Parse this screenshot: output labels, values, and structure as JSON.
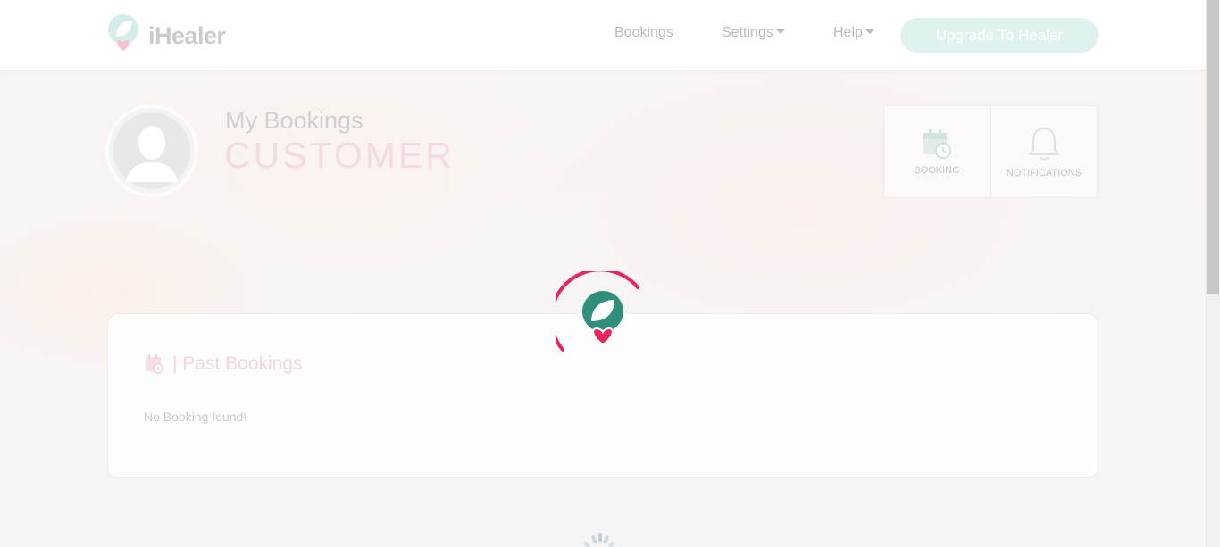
{
  "brand": {
    "name": "iHealer"
  },
  "nav": {
    "bookings": "Bookings",
    "settings": "Settings",
    "help": "Help",
    "upgrade": "Upgrade To Healer"
  },
  "profile": {
    "subtitle": "My Bookings",
    "title": "CUSTOMER"
  },
  "tiles": {
    "booking": "BOOKING",
    "notifications": "NOTIFICATIONS"
  },
  "past_bookings": {
    "heading": "| Past Bookings",
    "empty_message": "No Booking found!"
  },
  "colors": {
    "brand_teal": "#2f8f7a",
    "brand_pink": "#e8245f",
    "upgrade_bg": "#dff2ef"
  },
  "icons": {
    "logo": "leaf-heart-logo",
    "avatar": "user-silhouette-icon",
    "booking_tile": "calendar-clock-icon",
    "notifications_tile": "bell-icon",
    "past_bookings": "calendar-clock-icon",
    "loader": "spinner-icon"
  }
}
